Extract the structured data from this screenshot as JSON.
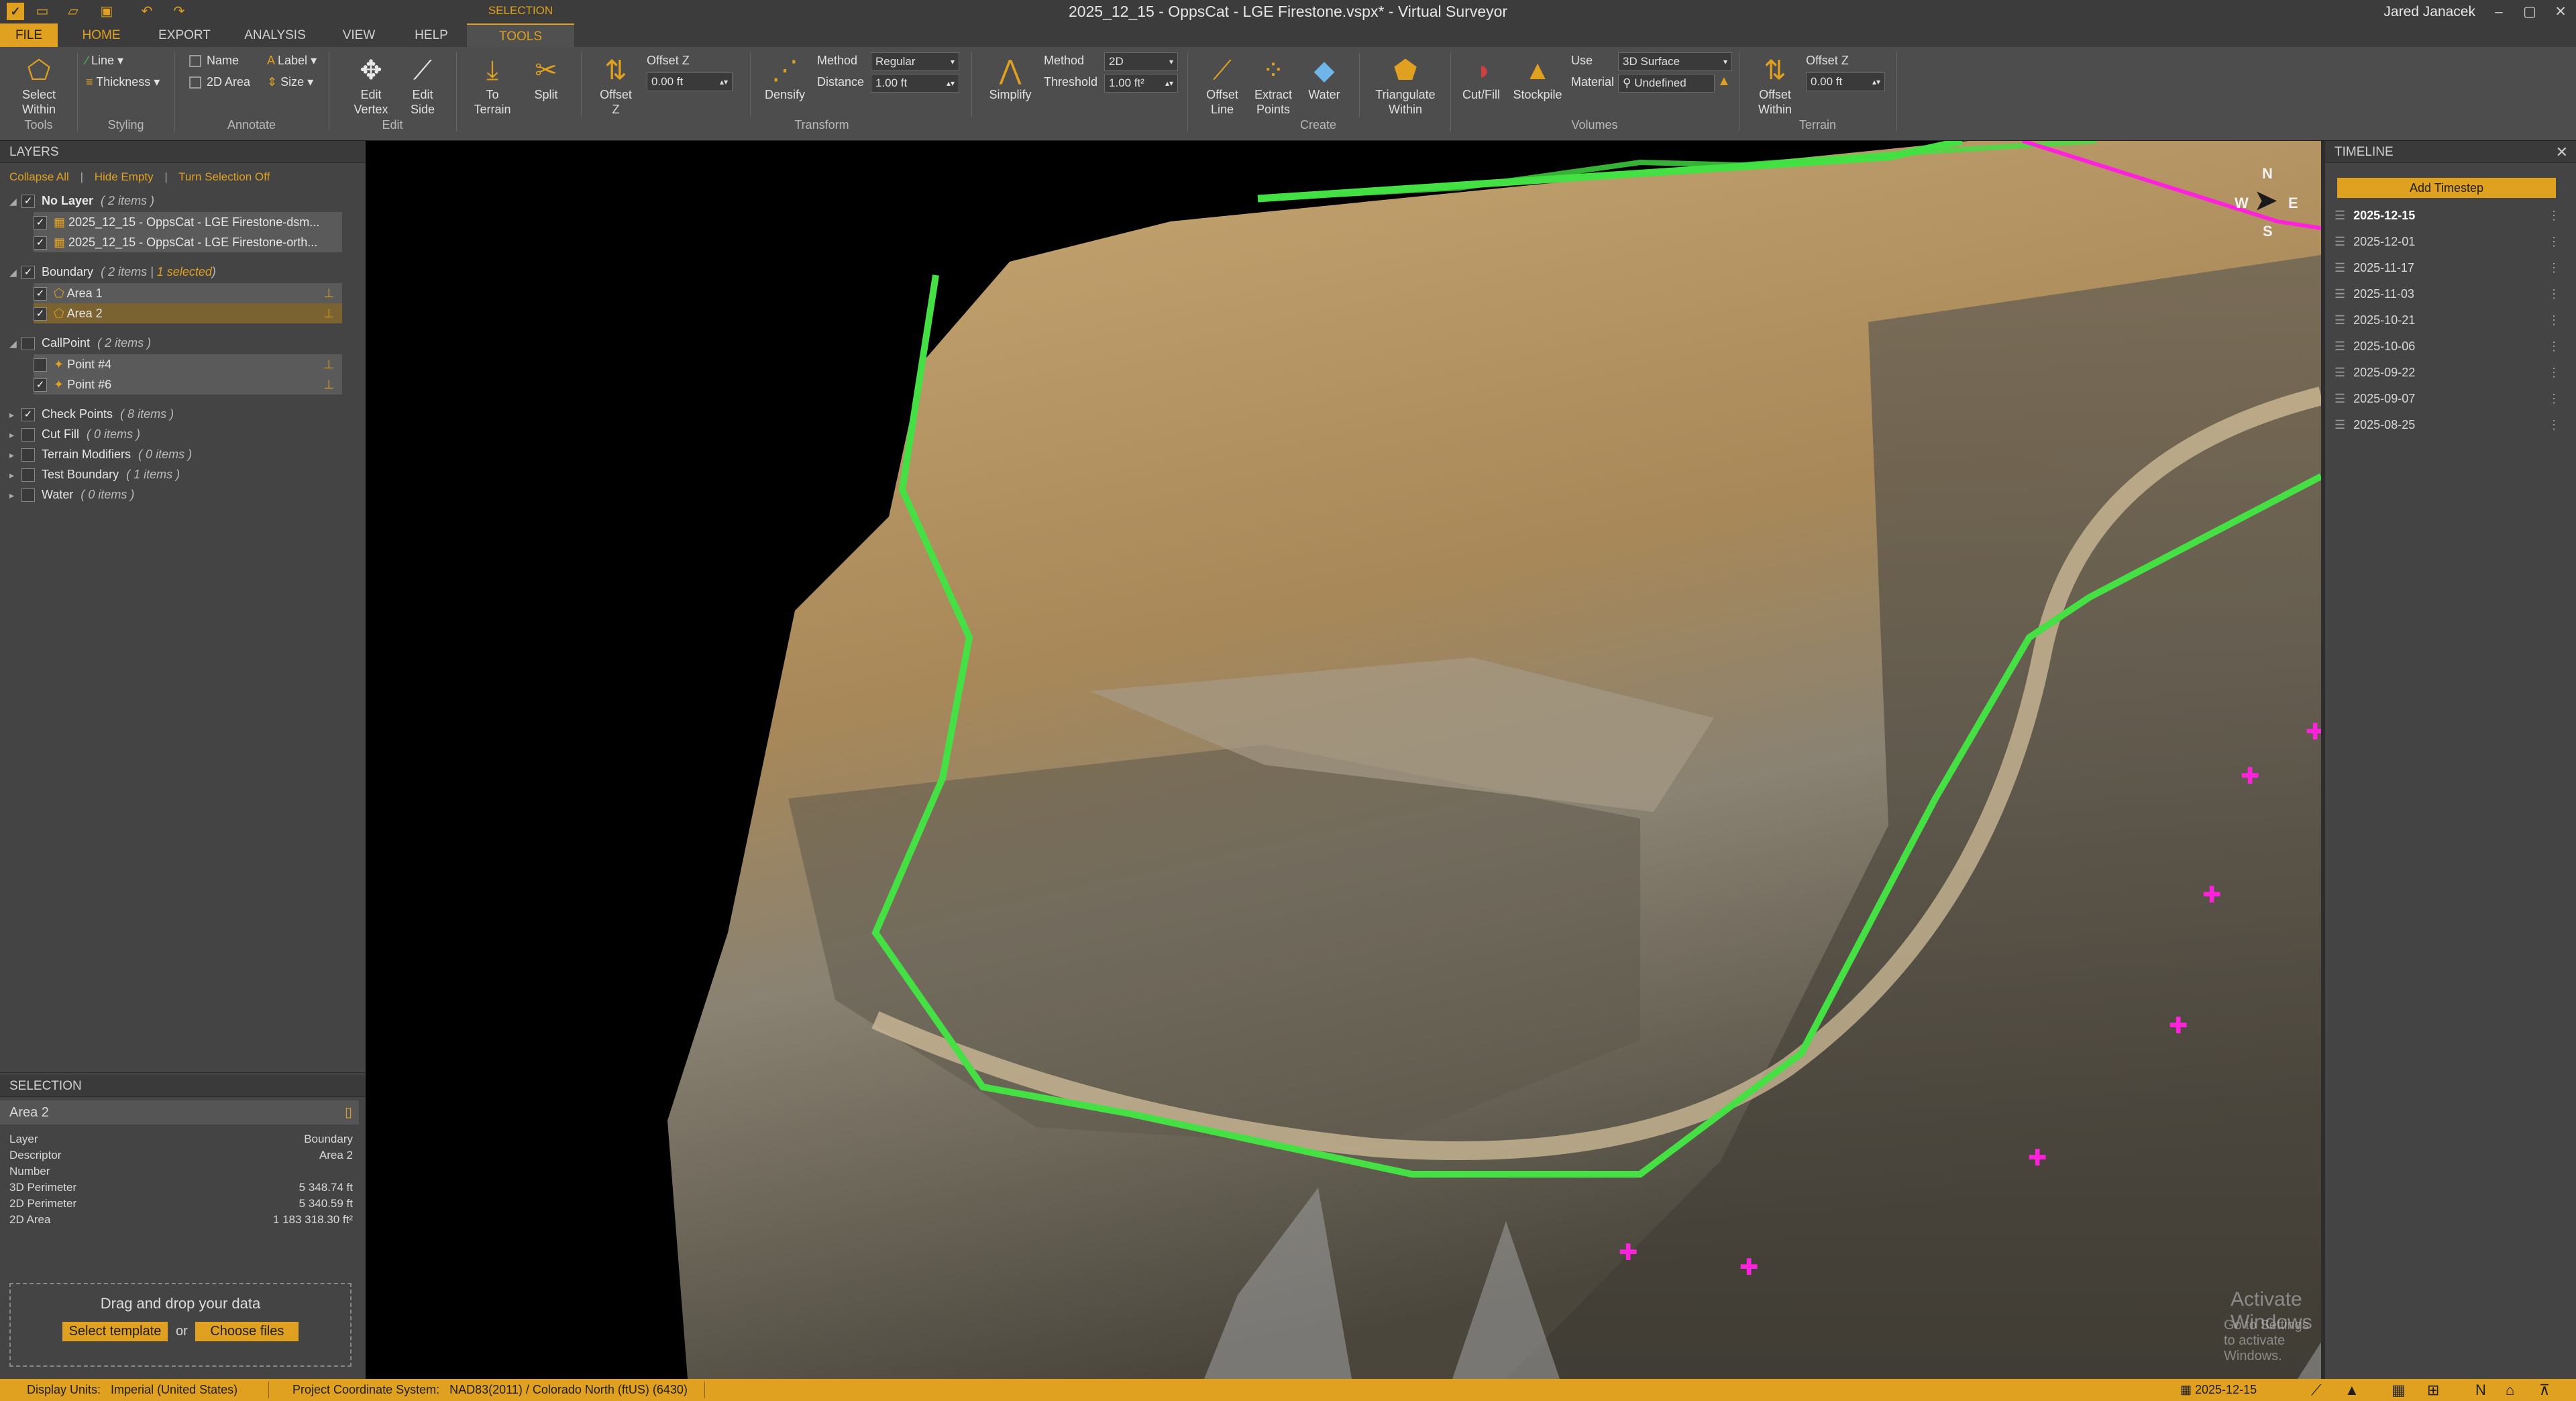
{
  "title_bar": {
    "title": "2025_12_15 - OppsCat - LGE Firestone.vspx* - Virtual Surveyor",
    "user": "Jared Janacek"
  },
  "menu": {
    "file": "FILE",
    "home": "HOME",
    "export": "EXPORT",
    "analysis": "ANALYSIS",
    "view": "VIEW",
    "help": "HELP",
    "context_group": "SELECTION",
    "tools": "TOOLS"
  },
  "ribbon": {
    "select_within": "Select Within",
    "line": "Line",
    "thickness": "Thickness",
    "name": "Name",
    "area_2d": "2D Area",
    "label": "Label",
    "size": "Size",
    "edit_vertex": "Edit Vertex",
    "edit_side": "Edit Side",
    "to_terrain": "To Terrain",
    "split": "Split",
    "offset_z_btn": "Offset Z",
    "offset_z_label": "Offset Z",
    "offset_z_value": "0.00 ft",
    "densify": "Densify",
    "method_label": "Method",
    "method_value": "Regular",
    "distance_label": "Distance",
    "distance_value": "1.00 ft",
    "simplify": "Simplify",
    "method2_label": "Method",
    "method2_value": "2D",
    "threshold_label": "Threshold",
    "threshold_value": "1.00 ft²",
    "offset_line": "Offset Line",
    "extract_points": "Extract Points",
    "water": "Water",
    "triangulate_within": "Triangulate Within",
    "cut_fill": "Cut/Fill",
    "stockpile": "Stockpile",
    "use_label": "Use",
    "use_value": "3D Surface",
    "material_label": "Material",
    "material_value": "Undefined",
    "offset_within": "Offset Within",
    "offset_z3_label": "Offset Z",
    "offset_z3_value": "0.00 ft",
    "groups": {
      "tools": "Tools",
      "styling": "Styling",
      "annotate": "Annotate",
      "edit": "Edit",
      "transform": "Transform",
      "create": "Create",
      "volumes": "Volumes",
      "terrain": "Terrain"
    }
  },
  "layers": {
    "title": "LAYERS",
    "collapse_all": "Collapse All",
    "hide_empty": "Hide Empty",
    "turn_selection_off": "Turn Selection Off",
    "no_layer": "No Layer",
    "no_layer_count": "( 2 items )",
    "file1": "2025_12_15 - OppsCat - LGE Firestone-dsm...",
    "file2": "2025_12_15 - OppsCat - LGE Firestone-orth...",
    "boundary": "Boundary",
    "boundary_count": "( 2 items |",
    "boundary_selected": "1 selected",
    "boundary_close": ")",
    "area1": "Area 1",
    "area2": "Area 2",
    "callpoint": "CallPoint",
    "callpoint_count": "( 2 items )",
    "point4": "Point #4",
    "point6": "Point #6",
    "check_points": "Check Points",
    "check_points_count": "( 8 items )",
    "cut_fill": "Cut Fill",
    "cut_fill_count": "( 0 items )",
    "terrain_modifiers": "Terrain Modifiers",
    "terrain_modifiers_count": "( 0 items )",
    "test_boundary": "Test Boundary",
    "test_boundary_count": "( 1 items )",
    "water": "Water",
    "water_count": "( 0 items )"
  },
  "selection": {
    "title": "SELECTION",
    "name": "Area 2",
    "props": [
      {
        "k": "Layer",
        "v": "Boundary"
      },
      {
        "k": "Descriptor",
        "v": "Area 2"
      },
      {
        "k": "Number",
        "v": ""
      },
      {
        "k": "3D Perimeter",
        "v": "5 348.74 ft"
      },
      {
        "k": "2D Perimeter",
        "v": "5 340.59 ft"
      },
      {
        "k": "2D Area",
        "v": "1 183 318.30 ft²"
      }
    ]
  },
  "dropzone": {
    "text": "Drag and drop your data",
    "select_template": "Select template",
    "or": "or",
    "choose_files": "Choose files"
  },
  "compass": {
    "n": "N",
    "e": "E",
    "s": "S",
    "w": "W"
  },
  "watermark": {
    "line1": "Activate Windows",
    "line2": "Go to Settings to activate Windows."
  },
  "timeline": {
    "title": "TIMELINE",
    "add": "Add Timestep",
    "dates": [
      "2025-12-15",
      "2025-12-01",
      "2025-11-17",
      "2025-11-03",
      "2025-10-21",
      "2025-10-06",
      "2025-09-22",
      "2025-09-07",
      "2025-08-25"
    ]
  },
  "status": {
    "display_units_label": "Display Units:",
    "display_units": "Imperial (United States)",
    "coord_label": "Project Coordinate System:",
    "coord": "NAD83(2011) / Colorado North (ftUS) (6430)",
    "date": "2025-12-15"
  },
  "colors": {
    "accent": "#e0a020",
    "boundary": "#44e044",
    "checkpoint": "#ff22dd"
  }
}
